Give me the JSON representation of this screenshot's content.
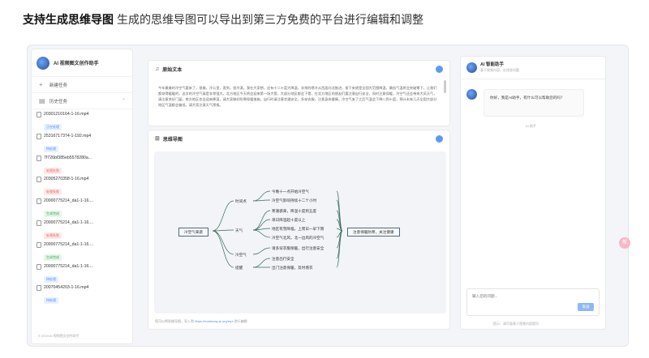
{
  "heading": {
    "bold": "支持生成思维导图",
    "sub": "生成的思维导图可以导出到第三方免费的平台进行编辑和调整"
  },
  "sidebar": {
    "title": "AI 视频图文创作助手",
    "new_task": "新建任务",
    "history": "历史任务",
    "tasks": [
      {
        "name": "20301210164-1-16.mp4",
        "status": "正在处理",
        "color": "blue"
      },
      {
        "name": "25316717374-1-192.mp4",
        "status": "待处理",
        "color": "blue"
      },
      {
        "name": "7f726bf385eb5578280a...",
        "status": "处理失败",
        "color": "red"
      },
      {
        "name": "20305270358-1-16.mp4",
        "status": "处理失败",
        "color": "red"
      },
      {
        "name": "20000775214_da1-1-16....",
        "status": "生成完成",
        "color": "green"
      },
      {
        "name": "20000775214_da1-1-16....",
        "status": "处理失败",
        "color": "red"
      },
      {
        "name": "20000775214_da1-1-16....",
        "status": "生成完成",
        "color": "green"
      },
      {
        "name": "20000775214_da1-1-16....",
        "status": "待处理",
        "color": "blue"
      },
      {
        "name": "20070454203-1-16.mp4",
        "status": "待处理",
        "color": "blue"
      }
    ],
    "footer": "© 2024 AI 视频图文创作助手"
  },
  "source": {
    "title": "原始文本",
    "text": "今年最美的冷空气要来了，很美，冷公里，直到，很冷漠，我在大家想，还有十二十度大降温，非常的寒冷从西面向北推进，接下来就是全国大范围降温，最低气温将会突破零下，让我们都穿得暖暖的，这次的冷空气真是非常强大。北方地区今天将会迎来第一场大雪，大部分地区都会下雪，在北方地区的朋友们要注意出行安全，同时注意保暖，冷空气还会带来大风天气，请注意关好门窗。南方地区也会迎来降温，请大家做好防寒保暖措施，出行时请注意交通安全，多穿衣服，注意身体健康。冷空气来了之后气温会下降八到十度，预计未来几天全国大部分地区气温都会偏低，请大家注意天气预报。"
  },
  "mindmap": {
    "title": "思维导图",
    "root": "冷空气来袭",
    "summary": "注意保暖防寒，关注健康",
    "branches": [
      {
        "label": "时间点",
        "children": [
          "今晚十一点开始冷空气",
          "冷空气影响持续十二个小时"
        ]
      },
      {
        "label": "天气",
        "children": [
          "寒潮袭来，降温十度到五度",
          "单日降温超十度以上",
          "地区有雪降临，上周日一早下雨",
          "冷空气北风，北一边风的冷空气"
        ]
      },
      {
        "label": "冷空气",
        "children": [
          "请多穿衣服保暖，出行注意安全"
        ]
      },
      {
        "label": "提醒",
        "children": [
          "注意出行安全",
          "出门注意保暖，及时增衣"
        ]
      }
    ],
    "footer_prefix": "您可以将思维导图，导入到",
    "footer_link": "https://markmap.js.org/repl",
    "footer_suffix": "进行编辑"
  },
  "chat": {
    "title": "AI 智能助手",
    "subtitle": "基于视频内容，在线答问题",
    "message": "你好，我是AI助手，有什么可以帮助您的吗？",
    "time": "AI 助手",
    "placeholder": "输入您的问题...",
    "send": "发送",
    "footer": "提示：请尽量基于视频内容提问"
  },
  "float_label": "帮"
}
